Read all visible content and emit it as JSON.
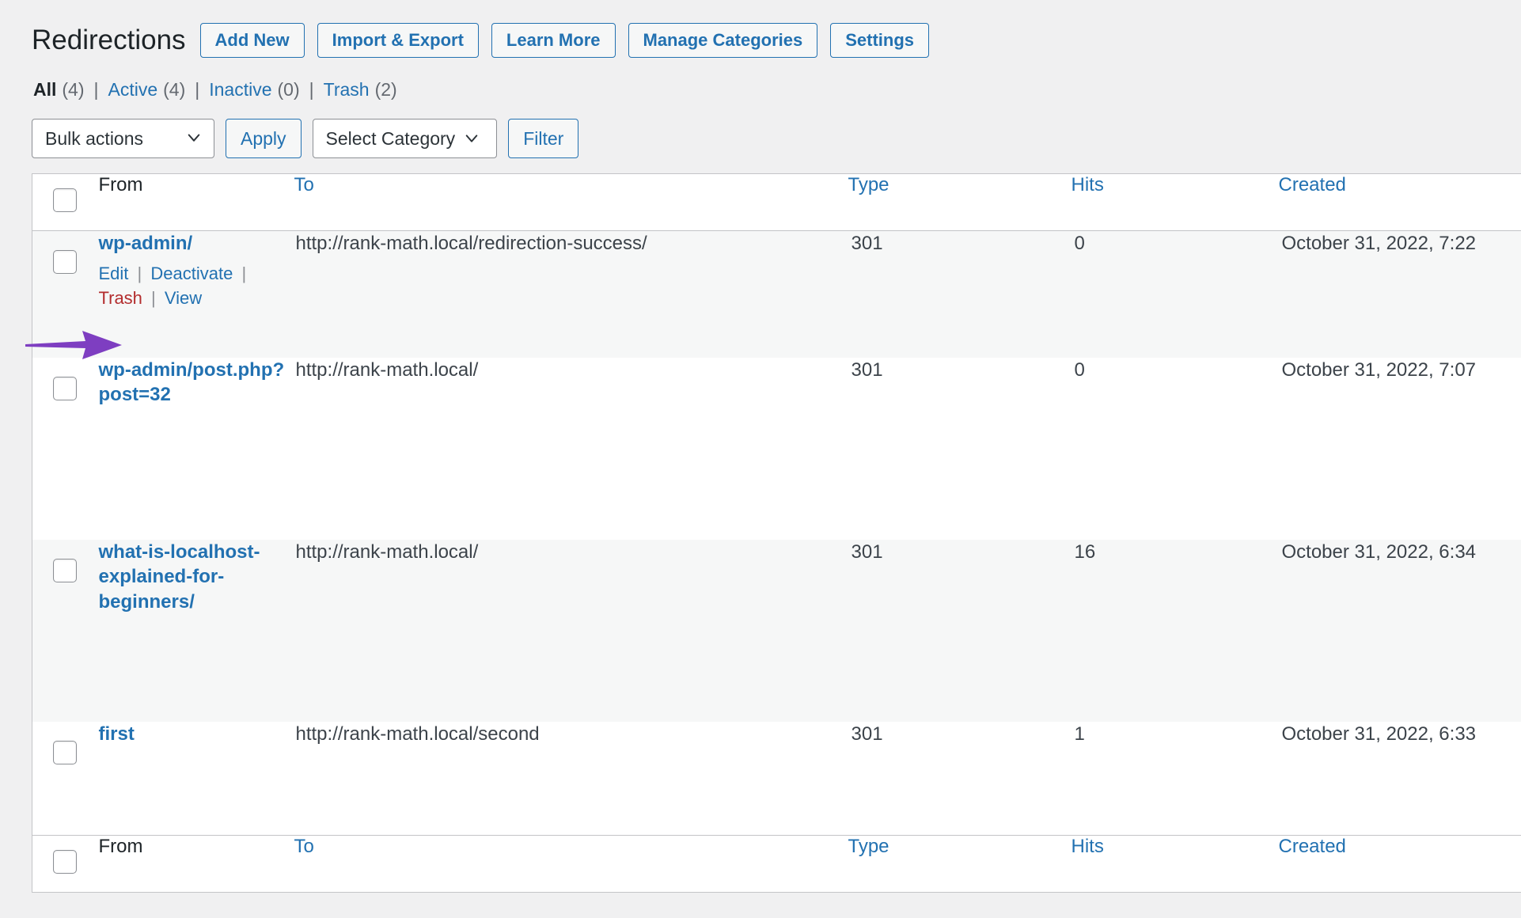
{
  "header": {
    "title": "Redirections",
    "actions": [
      {
        "label": "Add New",
        "name": "add-new-button"
      },
      {
        "label": "Import & Export",
        "name": "import-export-button"
      },
      {
        "label": "Learn More",
        "name": "learn-more-button"
      },
      {
        "label": "Manage Categories",
        "name": "manage-categories-button"
      },
      {
        "label": "Settings",
        "name": "settings-button"
      }
    ]
  },
  "filters": {
    "items": [
      {
        "label": "All",
        "count": "(4)",
        "current": true
      },
      {
        "label": "Active",
        "count": "(4)",
        "current": false
      },
      {
        "label": "Inactive",
        "count": "(0)",
        "current": false
      },
      {
        "label": "Trash",
        "count": "(2)",
        "current": false
      }
    ],
    "separator": "|"
  },
  "toolbar": {
    "bulk_actions_value": "Bulk actions",
    "apply_label": "Apply",
    "category_value": "Select Category",
    "filter_label": "Filter"
  },
  "table": {
    "columns": {
      "from": "From",
      "to": "To",
      "type": "Type",
      "hits": "Hits",
      "created": "Created"
    },
    "rows": [
      {
        "from": "wp-admin/",
        "to": "http://rank-math.local/redirection-success/",
        "type": "301",
        "hits": "0",
        "created": "October 31, 2022, 7:22",
        "actions": {
          "edit": "Edit",
          "deactivate": "Deactivate",
          "trash": "Trash",
          "view": "View",
          "separator": "|"
        }
      },
      {
        "from": "wp-admin/post.php?post=32",
        "to": "http://rank-math.local/",
        "type": "301",
        "hits": "0",
        "created": "October 31, 2022, 7:07"
      },
      {
        "from": "what-is-localhost-explained-for-beginners/",
        "to": "http://rank-math.local/",
        "type": "301",
        "hits": "16",
        "created": "October 31, 2022, 6:34"
      },
      {
        "from": "first",
        "to": "http://rank-math.local/second",
        "type": "301",
        "hits": "1",
        "created": "October 31, 2022, 6:33"
      }
    ]
  },
  "annotation": {
    "arrow_color": "#7e3ec1",
    "points_to": "Trash"
  },
  "colors": {
    "link": "#2271b1",
    "trash_link": "#b32d2e",
    "page_background": "#f0f0f1",
    "row_alt_background": "#f6f7f7",
    "border": "#c3c4c7"
  }
}
